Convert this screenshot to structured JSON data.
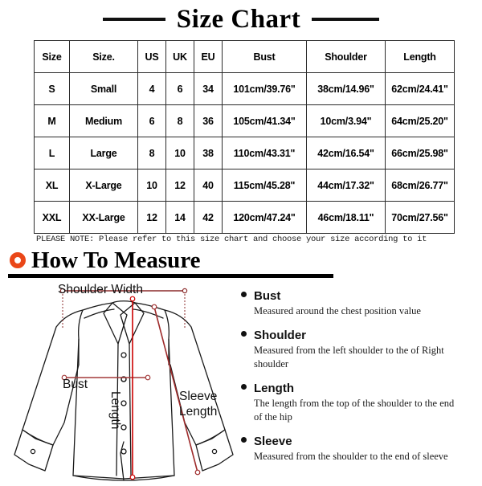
{
  "title": {
    "text": "Size Chart",
    "rule_color": "#111111"
  },
  "size_table": {
    "headers": [
      "Size",
      "Size.",
      "US",
      "UK",
      "EU",
      "Bust",
      "Shoulder",
      "Length"
    ],
    "rows": [
      {
        "size": "S",
        "size_name": "Small",
        "us": "4",
        "uk": "6",
        "eu": "34",
        "bust": "101cm/39.76\"",
        "shoulder": "38cm/14.96\"",
        "length": "62cm/24.41\""
      },
      {
        "size": "M",
        "size_name": "Medium",
        "us": "6",
        "uk": "8",
        "eu": "36",
        "bust": "105cm/41.34\"",
        "shoulder": "10cm/3.94\"",
        "length": "64cm/25.20\""
      },
      {
        "size": "L",
        "size_name": "Large",
        "us": "8",
        "uk": "10",
        "eu": "38",
        "bust": "110cm/43.31\"",
        "shoulder": "42cm/16.54\"",
        "length": "66cm/25.98\""
      },
      {
        "size": "XL",
        "size_name": "X-Large",
        "us": "10",
        "uk": "12",
        "eu": "40",
        "bust": "115cm/45.28\"",
        "shoulder": "44cm/17.32\"",
        "length": "68cm/26.77\""
      },
      {
        "size": "XXL",
        "size_name": "XX-Large",
        "us": "12",
        "uk": "14",
        "eu": "42",
        "bust": "120cm/47.24\"",
        "shoulder": "46cm/18.11\"",
        "length": "70cm/27.56\""
      }
    ]
  },
  "please_note": "PLEASE NOTE: Please refer to this size chart and choose your size according to it",
  "how_to_measure": {
    "heading": "How To Measure",
    "icon": "ring-icon",
    "icon_color": "#ea4718"
  },
  "diagram": {
    "shoulder_label": "Shoulder Width",
    "bust_label": "Bust",
    "length_label": "Length",
    "sleeve_label_line1": "Sleeve",
    "sleeve_label_line2": "Length",
    "measure_line_color": "#cc0000",
    "shoulder_line_color": "#8b2b2b",
    "outline_color": "#1a1a1a"
  },
  "measurements": [
    {
      "name": "Bust",
      "desc": "Measured around the chest position value"
    },
    {
      "name": "Shoulder",
      "desc": "Measured from the left shoulder to the of Right shoulder"
    },
    {
      "name": "Length",
      "desc": "The length from the top of the shoulder to the end of the hip"
    },
    {
      "name": "Sleeve",
      "desc": "Measured from the shoulder to the end of sleeve"
    }
  ]
}
